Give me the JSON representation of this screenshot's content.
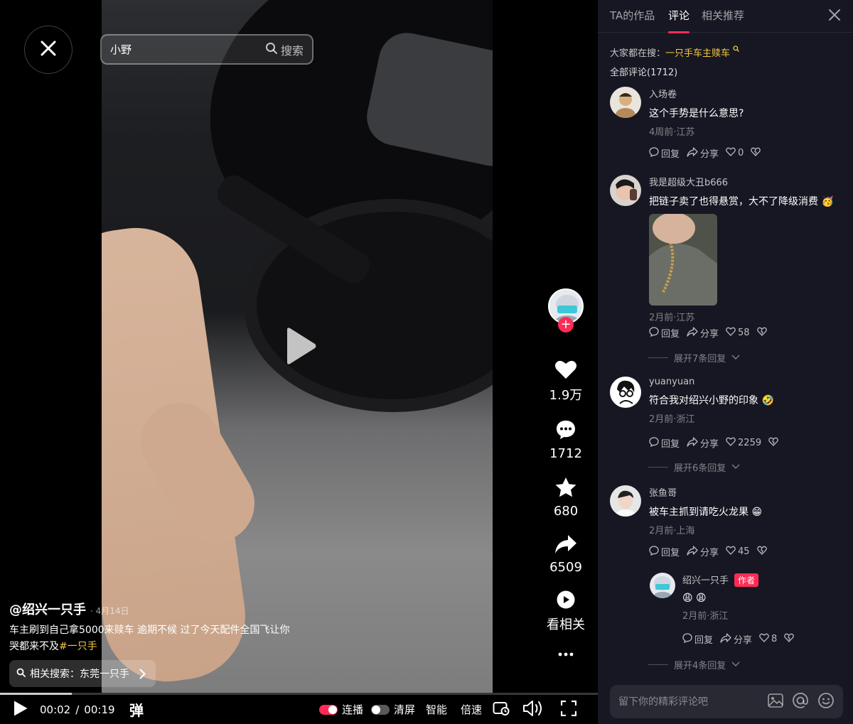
{
  "search": {
    "value": "小野",
    "button_label": "搜索"
  },
  "actions": {
    "likes": "1.9万",
    "comments": "1712",
    "favorites": "680",
    "shares": "6509",
    "related_label": "看相关"
  },
  "caption": {
    "author": "@绍兴一只手",
    "date": "· 4月14日",
    "text": "车主刷到自己拿5000来赎车 逾期不候 过了今天配件全国飞让你哭都来不及",
    "tag": "#一只手"
  },
  "related_search": {
    "label": "相关搜索：东莞一只手"
  },
  "player": {
    "current_time": "00:02",
    "separator": "/",
    "duration": "00:19",
    "progress": 0.12,
    "danmaku_label": "弹",
    "autoplay_label": "连播",
    "autoplay_on": true,
    "clear_label": "清屏",
    "clear_on": false,
    "smart_label": "智能",
    "speed_label": "倍速"
  },
  "panel": {
    "tabs": [
      "TA的作品",
      "评论",
      "相关推荐"
    ],
    "active_tab": 1,
    "trending_prefix": "大家都在搜：",
    "trending_term": "一只手车主赎车",
    "all_comments": "全部评论(1712)",
    "comment_placeholder": "留下你的精彩评论吧",
    "reply_label": "回复",
    "share_label": "分享"
  },
  "comments": [
    {
      "user": "入场卷",
      "text": "这个手势是什么意思?",
      "meta": "4周前·江苏",
      "likes": "0"
    },
    {
      "user": "我是超级大丑b666",
      "text": "把链子卖了也得悬赏，大不了降级消费",
      "emoji": "🥳",
      "meta": "2月前·江苏",
      "likes": "58",
      "expand": "展开7条回复"
    },
    {
      "user": "yuanyuan",
      "text": "符合我对绍兴小野的印象",
      "emoji": "🤣",
      "meta": "2月前·浙江",
      "likes": "2259",
      "expand": "展开6条回复"
    },
    {
      "user": "张鱼哥",
      "text": "被车主抓到请吃火龙果",
      "emoji": "😁",
      "meta": "2月前·上海",
      "likes": "45",
      "expand": "展开4条回复"
    }
  ],
  "reply": {
    "user": "绍兴一只手",
    "badge": "作者",
    "text": "😩 😩",
    "meta": "2月前·浙江",
    "likes": "8"
  },
  "colors": {
    "accent": "#fe2c55",
    "tag_yellow": "#f4c842",
    "panel_bg": "#161722"
  },
  "icons": [
    "close-icon",
    "search-icon",
    "play-icon",
    "heart-icon",
    "comment-icon",
    "star-icon",
    "share-icon",
    "related-icon",
    "more-icon",
    "danmaku-icon",
    "pip-icon",
    "volume-icon",
    "fullscreen-icon",
    "image-icon",
    "at-icon",
    "emoji-icon"
  ]
}
